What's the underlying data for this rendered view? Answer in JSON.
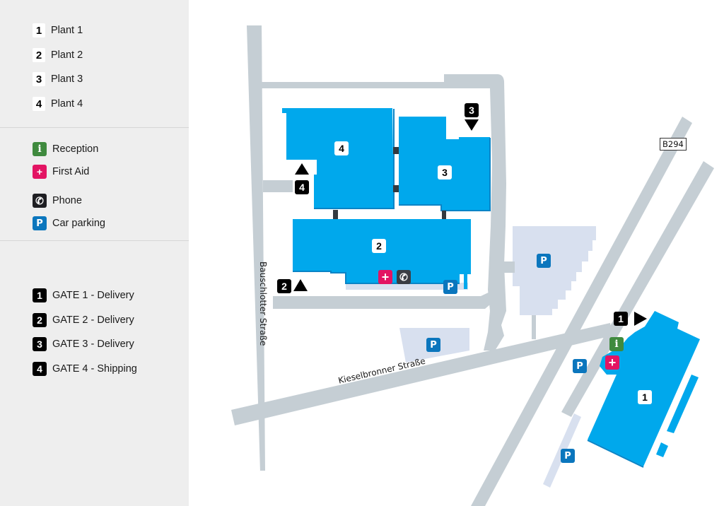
{
  "legend": {
    "plants": [
      {
        "number": "1",
        "label": "Plant 1"
      },
      {
        "number": "2",
        "label": "Plant 2"
      },
      {
        "number": "3",
        "label": "Plant 3"
      },
      {
        "number": "4",
        "label": "Plant 4"
      }
    ],
    "facilities": [
      {
        "icon": "reception-icon",
        "glyph": "i",
        "label": "Reception"
      },
      {
        "icon": "first-aid-icon",
        "glyph": "+",
        "label": "First Aid"
      },
      {
        "icon": "phone-icon",
        "glyph": "✆",
        "label": "Phone"
      },
      {
        "icon": "parking-icon",
        "glyph": "P",
        "label": "Car parking"
      }
    ],
    "gates": [
      {
        "number": "1",
        "label": "GATE 1 - Delivery"
      },
      {
        "number": "2",
        "label": "GATE 2 - Delivery"
      },
      {
        "number": "3",
        "label": "GATE 3 - Delivery"
      },
      {
        "number": "4",
        "label": "GATE 4 - Shipping"
      }
    ]
  },
  "map": {
    "streets": {
      "bauschlotter": "Bauschlotter Straße",
      "kieselbronner": "Kieselbronner Straße",
      "highway": "B294"
    },
    "plant_labels": {
      "p1": "1",
      "p2": "2",
      "p3": "3",
      "p4": "4"
    },
    "gate_labels": {
      "g1": "1",
      "g2": "2",
      "g3": "3",
      "g4": "4"
    },
    "icons": {
      "parking": "P",
      "reception": "i",
      "first_aid": "+",
      "phone": "✆"
    },
    "colors": {
      "building": "#00a8ec",
      "building_shadow": "#0a84c6",
      "road": "#c5ced4",
      "parking_area": "#d8e0ef",
      "sidebar_bg": "#eeeeee",
      "gate": "#000000",
      "reception": "#3f8a3e",
      "first_aid": "#e31463",
      "phone": "#1e1e22",
      "parking": "#0b76bd"
    }
  }
}
